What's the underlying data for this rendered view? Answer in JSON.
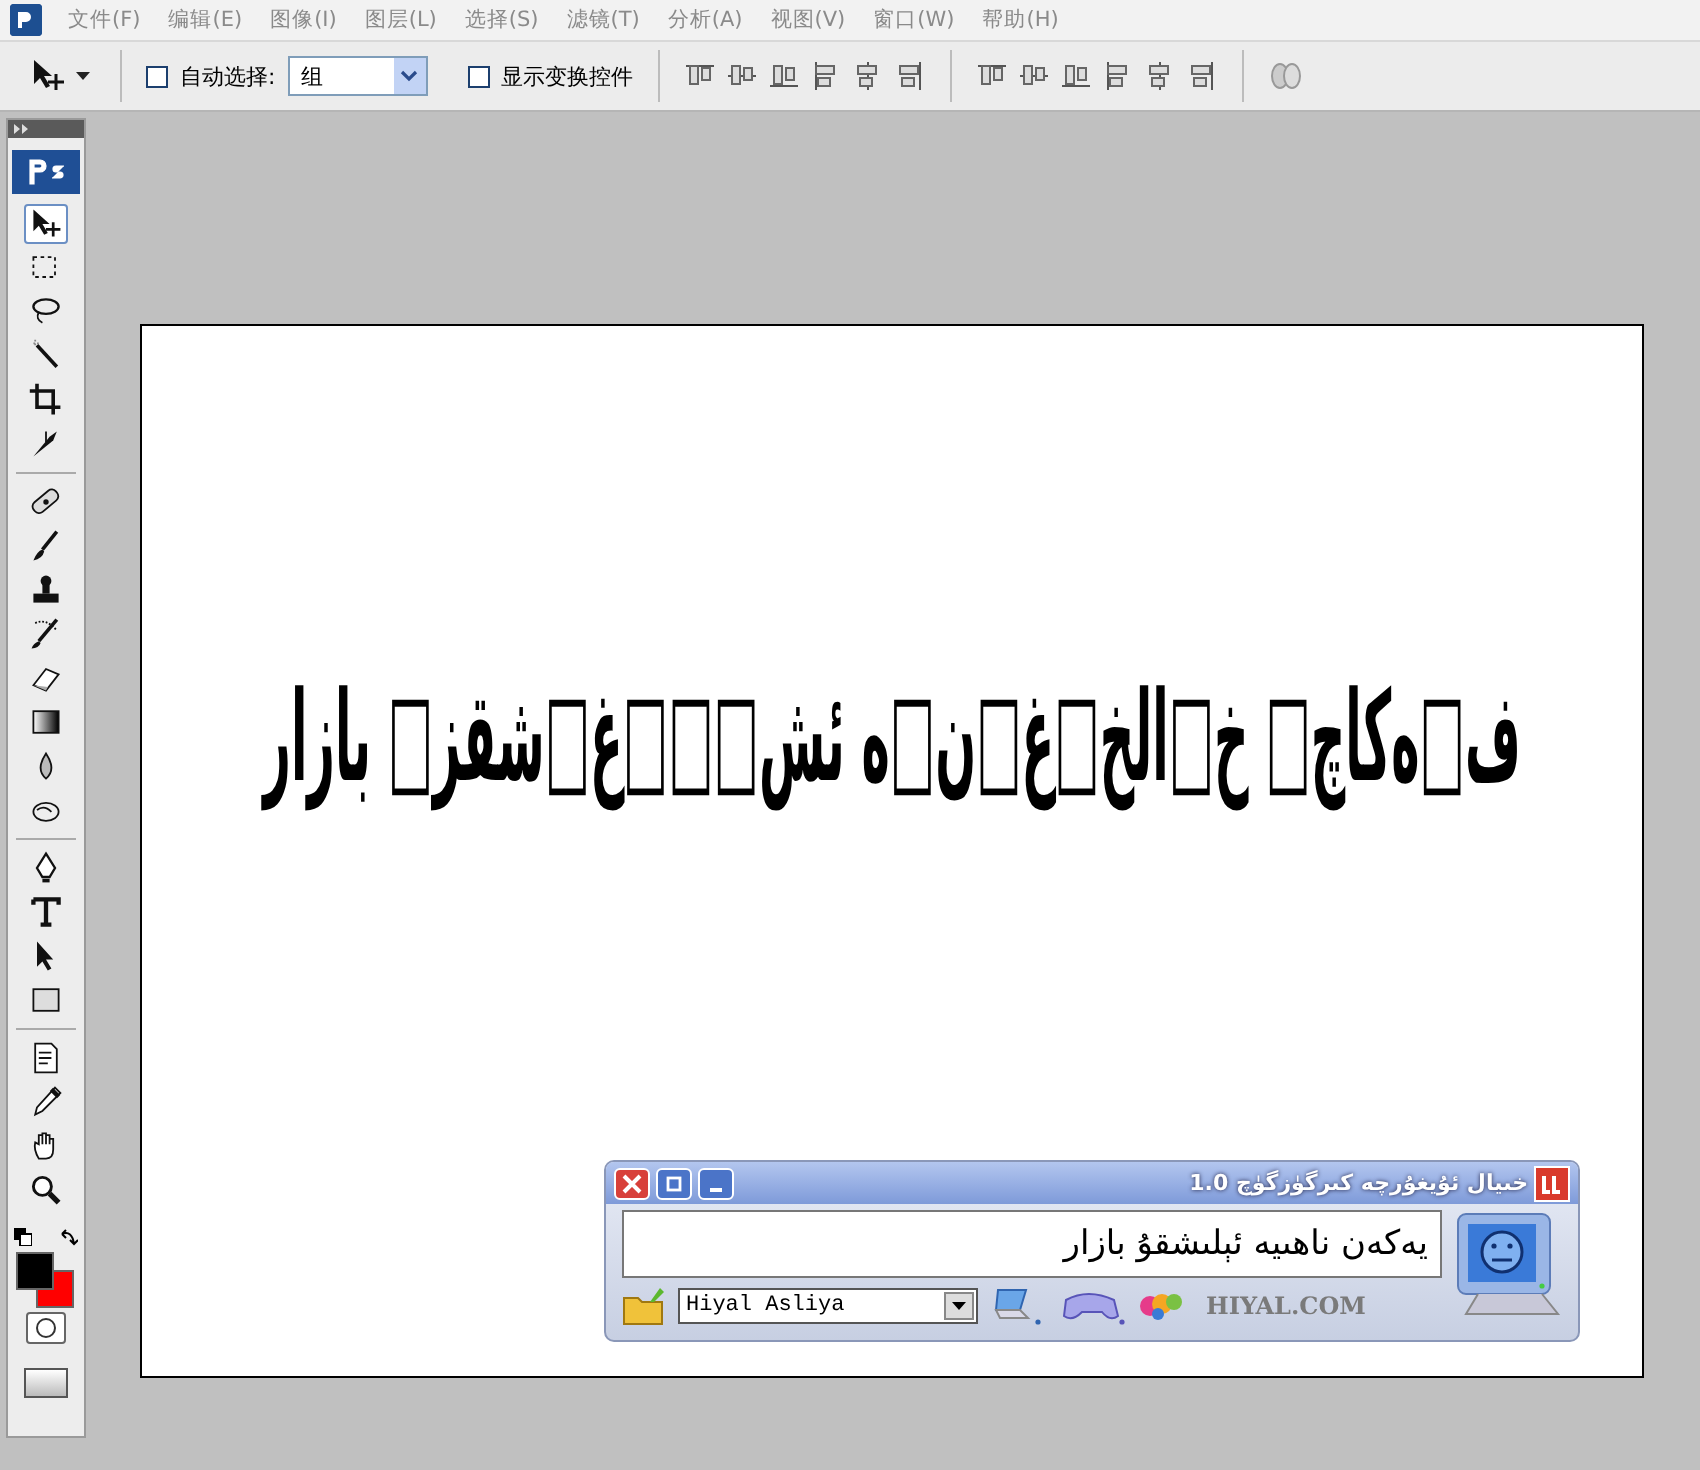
{
  "menu_bar": {
    "items": [
      {
        "label": "文件(F)"
      },
      {
        "label": "编辑(E)"
      },
      {
        "label": "图像(I)"
      },
      {
        "label": "图层(L)"
      },
      {
        "label": "选择(S)"
      },
      {
        "label": "滤镜(T)"
      },
      {
        "label": "分析(A)"
      },
      {
        "label": "视图(V)"
      },
      {
        "label": "窗口(W)"
      },
      {
        "label": "帮助(H)"
      }
    ]
  },
  "options_bar": {
    "auto_select": {
      "label": "自动选择:",
      "checked": false
    },
    "auto_select_target": {
      "value": "组"
    },
    "show_transform": {
      "label": "显示变换控件",
      "checked": false
    }
  },
  "toolbox": {
    "groups": [
      [
        {
          "kind": "move",
          "selected": true
        },
        {
          "kind": "marquee",
          "selected": false
        },
        {
          "kind": "lasso",
          "selected": false
        },
        {
          "kind": "wand",
          "selected": false
        },
        {
          "kind": "crop",
          "selected": false
        },
        {
          "kind": "slice",
          "selected": false
        }
      ],
      [
        {
          "kind": "heal",
          "selected": false
        },
        {
          "kind": "brush",
          "selected": false
        },
        {
          "kind": "stamp",
          "selected": false
        },
        {
          "kind": "history",
          "selected": false
        },
        {
          "kind": "eraser",
          "selected": false
        },
        {
          "kind": "gradient",
          "selected": false
        },
        {
          "kind": "blur",
          "selected": false
        },
        {
          "kind": "dodge",
          "selected": false
        }
      ],
      [
        {
          "kind": "pen",
          "selected": false
        },
        {
          "kind": "type",
          "selected": false
        },
        {
          "kind": "path",
          "selected": false
        },
        {
          "kind": "shape",
          "selected": false
        }
      ],
      [
        {
          "kind": "notes",
          "selected": false
        },
        {
          "kind": "eyedropper",
          "selected": false
        },
        {
          "kind": "hand",
          "selected": false
        },
        {
          "kind": "zoom",
          "selected": false
        }
      ]
    ]
  },
  "canvas": {
    "text": "ف□ەكاچ□ خ□الخ□غ□ن□ە ئش□□□غ□شقز□ بازار"
  },
  "ime_window": {
    "title": "خىيال ئۇيغۇرچە كىرگۈزگۈچ 1.0",
    "input": "يەكەن ناھىيە ئېلىشقۇ بازار",
    "font": "Hiyal Asliya",
    "brand": "HIYAL.COM"
  }
}
